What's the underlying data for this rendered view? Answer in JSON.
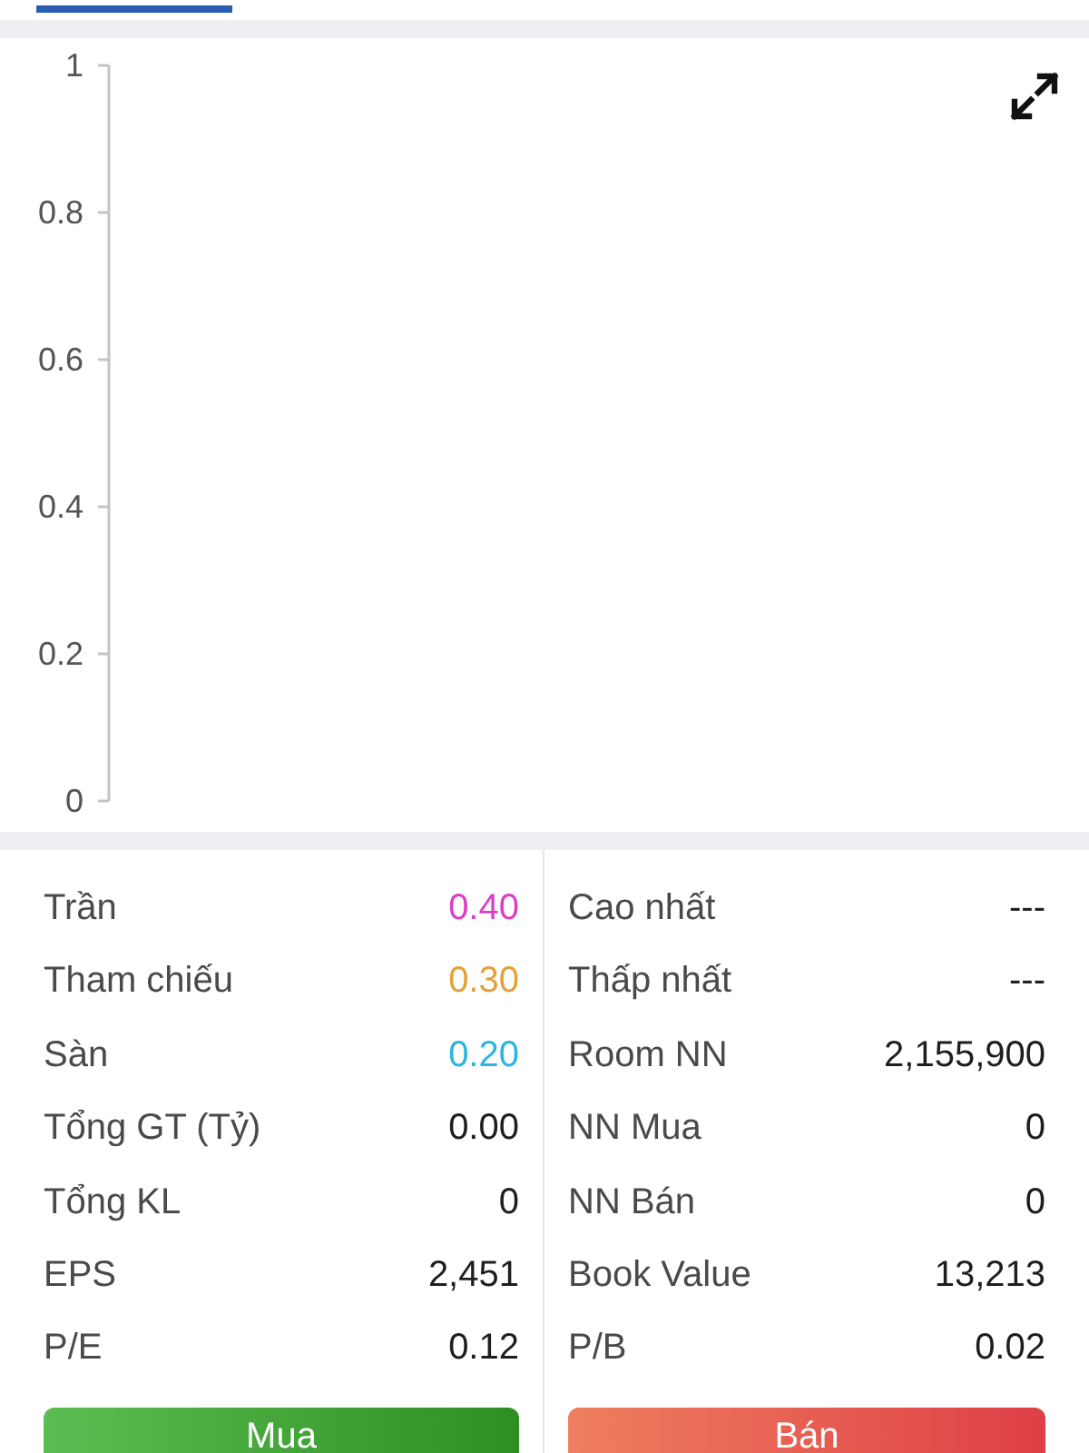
{
  "tabs": [
    {
      "selected": true
    }
  ],
  "chart": {
    "y_axis_labels": [
      "1",
      "0.8",
      "0.6",
      "0.4",
      "0.2",
      "0"
    ]
  },
  "stats_left": [
    {
      "label": "Trần",
      "value": "0.40",
      "color": "#dc3fc8"
    },
    {
      "label": "Tham chiếu",
      "value": "0.30",
      "color": "#e5a13a"
    },
    {
      "label": "Sàn",
      "value": "0.20",
      "color": "#2bb5e0"
    },
    {
      "label": "Tổng GT (Tỷ)",
      "value": "0.00"
    },
    {
      "label": "Tổng KL",
      "value": "0"
    },
    {
      "label": "EPS",
      "value": "2,451"
    },
    {
      "label": "P/E",
      "value": "0.12"
    }
  ],
  "stats_right": [
    {
      "label": "Cao nhất",
      "value": "---"
    },
    {
      "label": "Thấp nhất",
      "value": "---"
    },
    {
      "label": "Room NN",
      "value": "2,155,900"
    },
    {
      "label": "NN Mua",
      "value": "0"
    },
    {
      "label": "NN Bán",
      "value": "0"
    },
    {
      "label": "Book Value",
      "value": "13,213"
    },
    {
      "label": "P/B",
      "value": "0.02"
    }
  ],
  "buttons": [
    {
      "kind": "buy",
      "label": "Mua"
    },
    {
      "kind": "sell",
      "label": "Bán"
    }
  ]
}
